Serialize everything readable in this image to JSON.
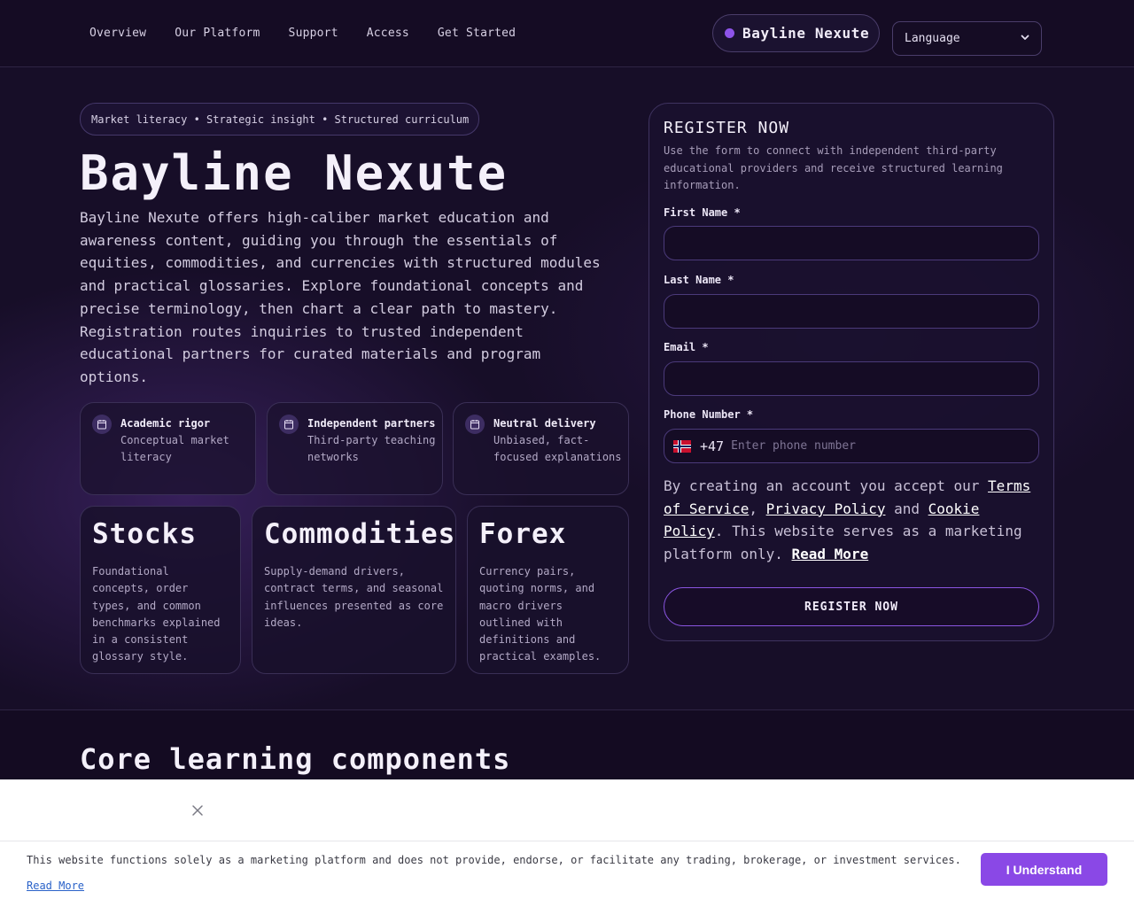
{
  "nav": {
    "links": [
      "Overview",
      "Our Platform",
      "Support",
      "Access",
      "Get Started"
    ],
    "brand": "Bayline Nexute",
    "language_label": "Language"
  },
  "hero": {
    "tagline": "Market literacy • Strategic insight • Structured curriculum",
    "title": "Bayline Nexute",
    "description": "Bayline Nexute offers high-caliber market education and awareness content, guiding you through the essentials of equities, commodities, and currencies with structured modules and practical glossaries. Explore foundational concepts and precise terminology, then chart a clear path to mastery. Registration routes inquiries to trusted independent educational partners for curated materials and program options.",
    "features": [
      {
        "title": "Academic rigor",
        "desc": "Conceptual market literacy"
      },
      {
        "title": "Independent partners",
        "desc": "Third-party teaching networks"
      },
      {
        "title": "Neutral delivery",
        "desc": "Unbiased, fact-focused explanations"
      }
    ],
    "cards": [
      {
        "title": "Stocks",
        "desc": "Foundational concepts, order types, and common benchmarks explained in a consistent glossary style."
      },
      {
        "title": "Commodities",
        "desc": "Supply-demand drivers, contract terms, and seasonal influences presented as core ideas."
      },
      {
        "title": "Forex",
        "desc": "Currency pairs, quoting norms, and macro drivers outlined with definitions and practical examples."
      }
    ]
  },
  "form": {
    "title": "REGISTER NOW",
    "subtitle": "Use the form to connect with independent third-party educational providers and receive structured learning information.",
    "first_name_label": "First Name *",
    "last_name_label": "Last Name *",
    "email_label": "Email *",
    "phone_label": "Phone Number *",
    "country_code": "+47",
    "phone_placeholder": "Enter phone number",
    "consent": {
      "prefix": "By creating an account you accept our ",
      "terms": "Terms of Service",
      "sep1": ", ",
      "privacy": "Privacy Policy",
      "sep2": " and ",
      "cookie": "Cookie Policy",
      "suffix": ". This website serves as a marketing platform only. ",
      "read_more": "Read More"
    },
    "submit_label": "REGISTER NOW"
  },
  "section2": {
    "title": "Core learning components"
  },
  "cookie_bar": {
    "text": "This website functions solely as a marketing platform and does not provide, endorse, or facilitate any trading, brokerage, or investment services.",
    "read_more": "Read More",
    "button_label": "I Understand"
  },
  "colors": {
    "accent": "#8a48e6",
    "background": "#170e28",
    "brand_dot": "#8e54e9"
  },
  "icons": [
    "chevron-down-icon",
    "calendar-icon",
    "close-icon",
    "norway-flag-icon"
  ]
}
